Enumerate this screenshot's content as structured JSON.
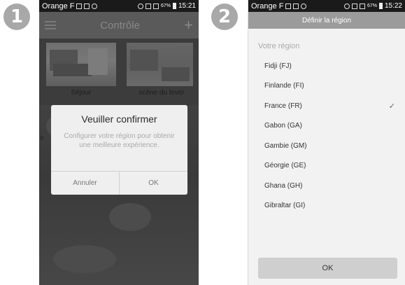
{
  "steps": [
    "1",
    "2"
  ],
  "screen1": {
    "status": {
      "carrier": "Orange F",
      "battery": "67%",
      "time": "15:21"
    },
    "header": {
      "title": "Contrôle",
      "add_icon": "+"
    },
    "scenes": [
      {
        "label": "Séjour"
      },
      {
        "label": "scène du lever"
      }
    ],
    "background_fragment": "p",
    "dialog": {
      "title": "Veuiller confirmer",
      "message": "Configurer votre région pour obtenir une meilleure expérience.",
      "cancel": "Annuler",
      "ok": "OK"
    }
  },
  "screen2": {
    "status": {
      "carrier": "Orange F",
      "battery": "67%",
      "time": "15:22"
    },
    "header": {
      "title": "Définir la région"
    },
    "section_label": "Votre région",
    "regions": [
      {
        "name": "Fidji (FJ)",
        "selected": false
      },
      {
        "name": "Finlande (FI)",
        "selected": false
      },
      {
        "name": "France (FR)",
        "selected": true
      },
      {
        "name": "Gabon (GA)",
        "selected": false
      },
      {
        "name": "Gambie (GM)",
        "selected": false
      },
      {
        "name": "Géorgie (GE)",
        "selected": false
      },
      {
        "name": "Ghana (GH)",
        "selected": false
      },
      {
        "name": "Gibraltar (GI)",
        "selected": false
      }
    ],
    "check_icon": "✓",
    "ok_button": "OK"
  },
  "colors": {
    "badge": "#a8a8a8",
    "overlay": "#3c3c3c",
    "dialog_bg": "#efefef",
    "header2_bg": "#9b9b9b",
    "ok_button_bg": "#cfcfcf"
  }
}
